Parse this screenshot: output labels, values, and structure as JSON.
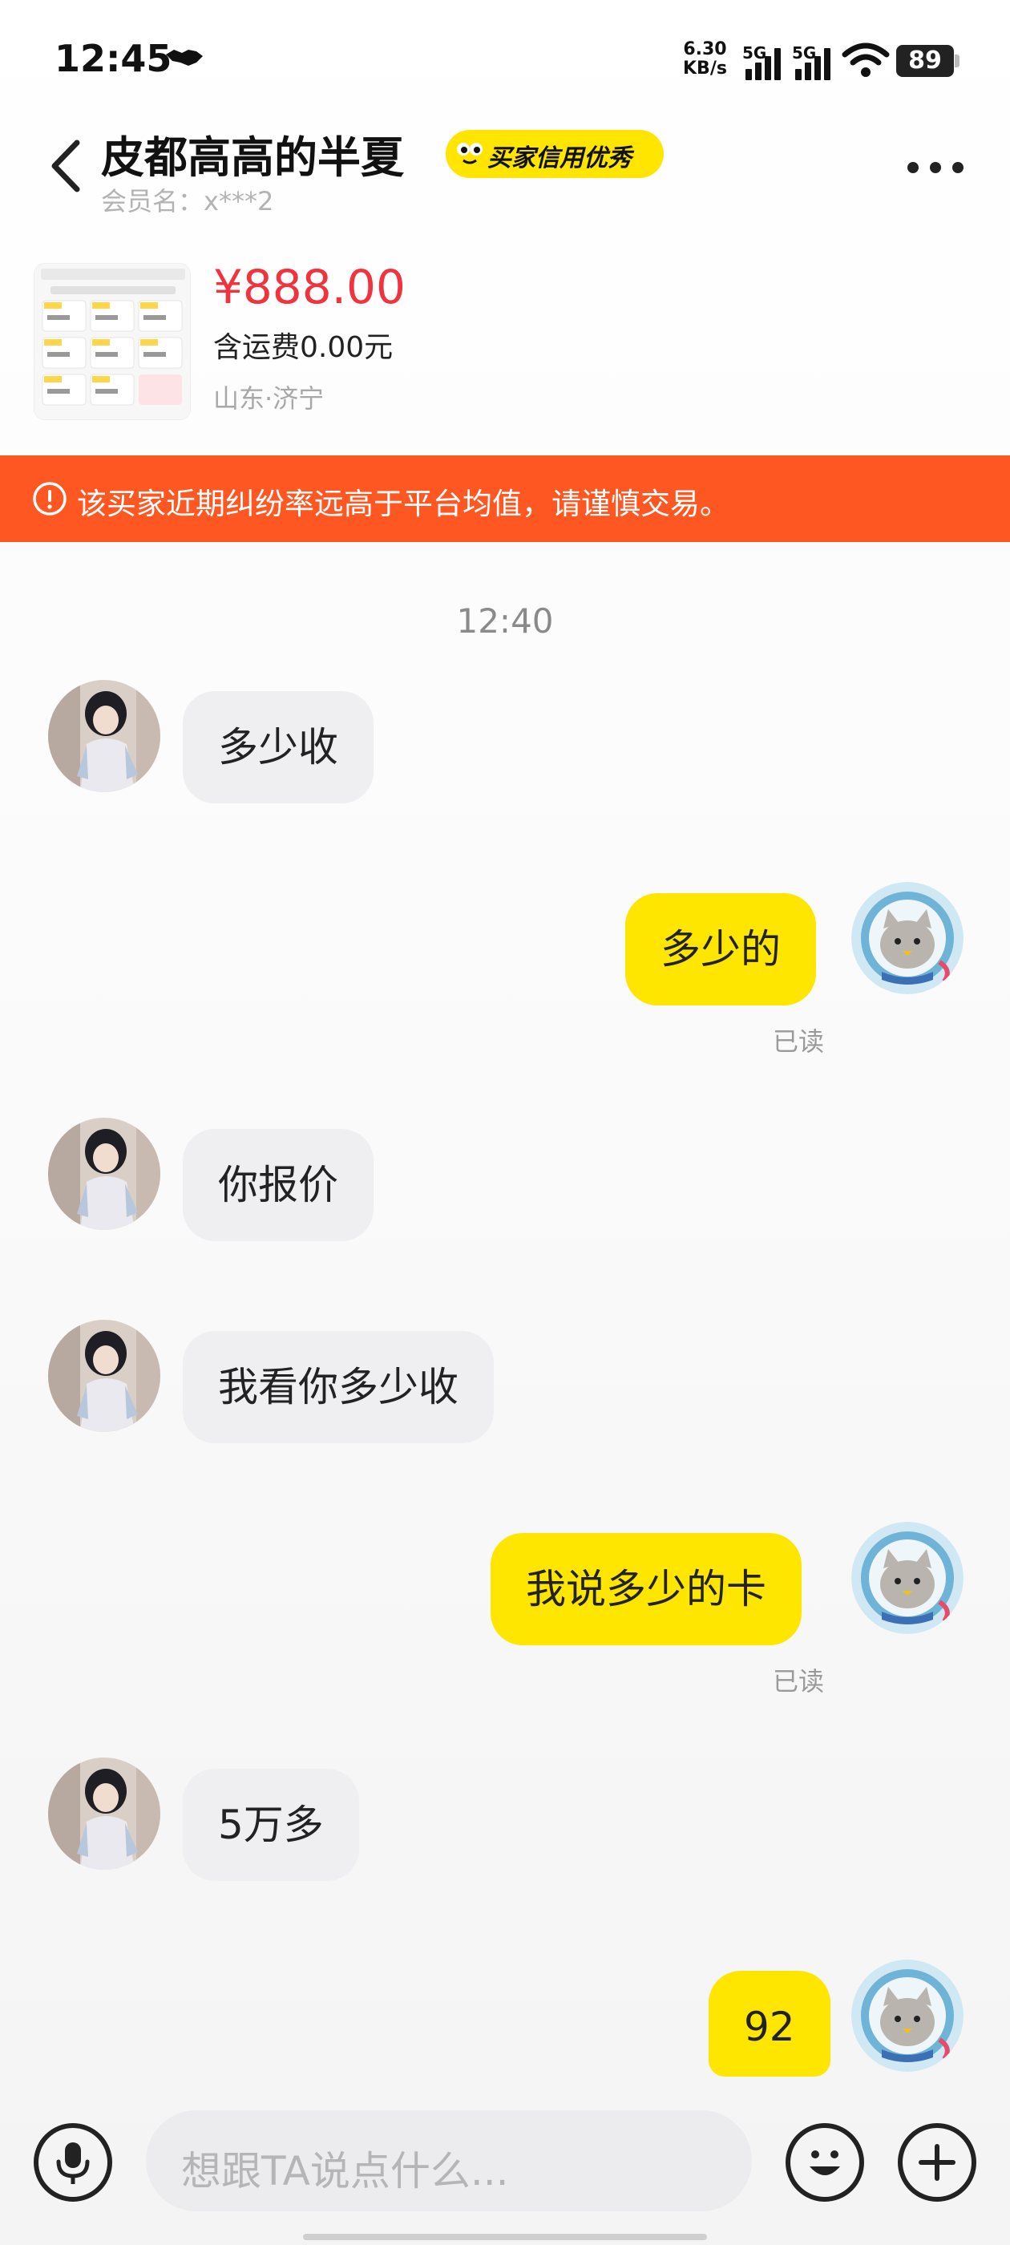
{
  "status_bar": {
    "time": "12:45",
    "net_speed_value": "6.30",
    "net_speed_unit": "KB/s",
    "signal1_label": "5G",
    "signal2_label": "5G",
    "battery": "89"
  },
  "header": {
    "title": "皮都高高的半夏",
    "credit_badge": "买家信用优秀",
    "member_name": "会员名：x***2"
  },
  "product": {
    "price": "¥888.00",
    "shipping": "含运费0.00元",
    "location": "山东·济宁"
  },
  "warning": {
    "text": "该买家近期纠纷率远高于平台均值，请谨慎交易。"
  },
  "chat": {
    "time_divider": "12:40",
    "messages": [
      {
        "side": "in",
        "text": "多少收"
      },
      {
        "side": "out",
        "text": "多少的",
        "status": "已读"
      },
      {
        "side": "in",
        "text": "你报价"
      },
      {
        "side": "in",
        "text": "我看你多少收"
      },
      {
        "side": "out",
        "text": "我说多少的卡",
        "status": "已读"
      },
      {
        "side": "in",
        "text": "5万多"
      },
      {
        "side": "out",
        "text": "92"
      }
    ]
  },
  "input": {
    "placeholder": "想跟TA说点什么..."
  },
  "colors": {
    "accent_yellow": "#ffe600",
    "price_red": "#f0333d",
    "warning_orange": "#ff5722"
  }
}
